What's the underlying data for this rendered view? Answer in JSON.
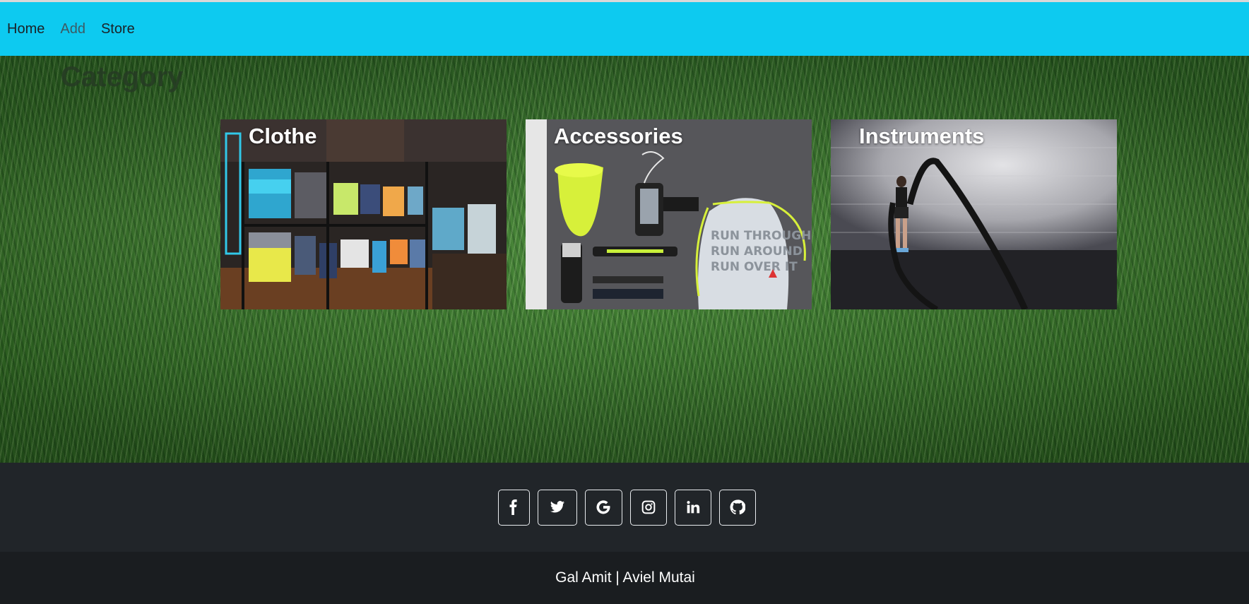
{
  "navbar": {
    "links": [
      {
        "label": "Home"
      },
      {
        "label": "Add"
      },
      {
        "label": "Store"
      }
    ],
    "accent": "#0dcaf0"
  },
  "hero": {
    "title": "Category"
  },
  "categories": [
    {
      "title": "Clothe",
      "image": "clothing-store-rack"
    },
    {
      "title": "Accessories",
      "image": "sport-accessories-flatlay"
    },
    {
      "title": "Instruments",
      "image": "battle-ropes-workout"
    }
  ],
  "footer": {
    "social_icons": [
      "facebook-icon",
      "twitter-icon",
      "google-icon",
      "instagram-icon",
      "linkedin-icon",
      "github-icon"
    ],
    "credit": "Gal Amit | Aviel Mutai"
  }
}
